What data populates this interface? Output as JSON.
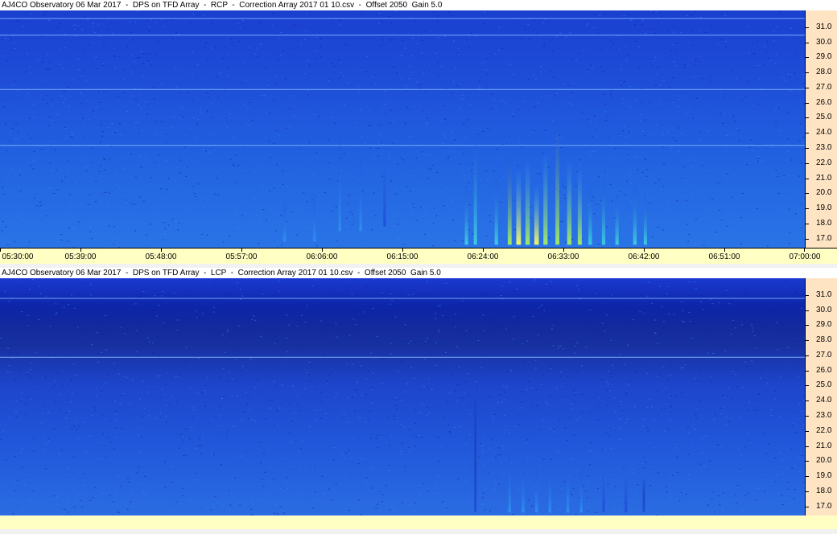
{
  "panels": [
    {
      "title": "AJ4CO Observatory 06 Mar 2017  -  DPS on TFD Array  -  RCP  -  Correction Array 2017 01 10.csv  -  Offset 2050  Gain 5.0"
    },
    {
      "title": "AJ4CO Observatory 06 Mar 2017  -  DPS on TFD Array  -  LCP  -  Correction Array 2017 01 10.csv  -  Offset 2050  Gain 5.0"
    }
  ],
  "chart_data": [
    {
      "type": "heatmap",
      "title": "AJ4CO Observatory 06 Mar 2017  -  DPS on TFD Array  -  RCP  -  Correction Array 2017 01 10.csv  -  Offset 2050  Gain 5.0",
      "polarization": "RCP",
      "x_ticks": [
        "05:30:00",
        "05:39:00",
        "05:48:00",
        "05:57:00",
        "06:06:00",
        "06:15:00",
        "06:24:00",
        "06:33:00",
        "06:42:00",
        "06:51:00",
        "07:00:00"
      ],
      "y_ticks": [
        "31.0",
        "30.0",
        "29.0",
        "28.0",
        "27.0",
        "26.0",
        "25.0",
        "24.0",
        "23.0",
        "22.0",
        "21.0",
        "20.0",
        "19.0",
        "18.0",
        "17.0"
      ],
      "xlim": [
        "05:30:00",
        "07:00:00"
      ],
      "ylim": [
        16.4,
        32.1
      ],
      "colormap": [
        "#0a1a8c",
        "#1e4ed8",
        "#2f8ff0",
        "#40d0e0",
        "#a8f060",
        "#ffff60"
      ],
      "hot_lines_mhz": [
        31.6,
        30.5,
        26.9,
        23.2
      ],
      "bursts": [
        {
          "t": "06:01:50",
          "mhz": [
            16.8,
            19.5
          ],
          "level": 0.45
        },
        {
          "t": "06:05:10",
          "mhz": [
            16.8,
            20.0
          ],
          "level": 0.4
        },
        {
          "t": "06:08:00",
          "mhz": [
            17.5,
            23.8
          ],
          "level": 0.3
        },
        {
          "t": "06:10:20",
          "mhz": [
            17.5,
            22.5
          ],
          "level": 0.3
        },
        {
          "t": "06:13:00",
          "mhz": [
            17.8,
            21.5
          ],
          "level": 0.25
        },
        {
          "t": "06:22:10",
          "mhz": [
            16.6,
            20.5
          ],
          "level": 0.55
        },
        {
          "t": "06:23:10",
          "mhz": [
            16.6,
            24.2
          ],
          "level": 0.5
        },
        {
          "t": "06:25:30",
          "mhz": [
            16.6,
            21.0
          ],
          "level": 0.55
        },
        {
          "t": "06:27:00",
          "mhz": [
            16.6,
            22.5
          ],
          "level": 0.7
        },
        {
          "t": "06:28:00",
          "mhz": [
            16.6,
            21.5
          ],
          "level": 0.95
        },
        {
          "t": "06:29:00",
          "mhz": [
            16.6,
            22.0
          ],
          "level": 0.85
        },
        {
          "t": "06:30:00",
          "mhz": [
            16.6,
            20.5
          ],
          "level": 0.9
        },
        {
          "t": "06:31:00",
          "mhz": [
            16.6,
            22.5
          ],
          "level": 0.8
        },
        {
          "t": "06:32:20",
          "mhz": [
            16.6,
            25.0
          ],
          "level": 0.7
        },
        {
          "t": "06:33:40",
          "mhz": [
            16.6,
            22.0
          ],
          "level": 0.85
        },
        {
          "t": "06:34:50",
          "mhz": [
            16.6,
            21.5
          ],
          "level": 0.75
        },
        {
          "t": "06:36:00",
          "mhz": [
            16.6,
            20.5
          ],
          "level": 0.6
        },
        {
          "t": "06:37:30",
          "mhz": [
            16.6,
            21.0
          ],
          "level": 0.55
        },
        {
          "t": "06:39:00",
          "mhz": [
            16.6,
            20.0
          ],
          "level": 0.55
        },
        {
          "t": "06:41:00",
          "mhz": [
            16.6,
            20.5
          ],
          "level": 0.6
        },
        {
          "t": "06:42:10",
          "mhz": [
            16.6,
            19.8
          ],
          "level": 0.5
        }
      ],
      "legend": "none",
      "grid": false
    },
    {
      "type": "heatmap",
      "title": "AJ4CO Observatory 06 Mar 2017  -  DPS on TFD Array  -  LCP  -  Correction Array 2017 01 10.csv  -  Offset 2050  Gain 5.0",
      "polarization": "LCP",
      "x_ticks": [],
      "y_ticks": [
        "31.0",
        "30.0",
        "29.0",
        "28.0",
        "27.0",
        "26.0",
        "25.0",
        "24.0",
        "23.0",
        "22.0",
        "21.0",
        "20.0",
        "19.0",
        "18.0",
        "17.0"
      ],
      "xlim": [
        "05:30:00",
        "07:00:00"
      ],
      "ylim": [
        16.4,
        32.1
      ],
      "colormap": [
        "#0a1a8c",
        "#1e4ed8",
        "#2f8ff0",
        "#40d0e0",
        "#a8f060",
        "#ffff60"
      ],
      "hot_lines_mhz": [
        30.8,
        26.9
      ],
      "bursts": [
        {
          "t": "06:23:10",
          "mhz": [
            16.6,
            24.0
          ],
          "level": 0.2
        },
        {
          "t": "06:27:00",
          "mhz": [
            16.6,
            20.5
          ],
          "level": 0.35
        },
        {
          "t": "06:28:30",
          "mhz": [
            16.6,
            20.0
          ],
          "level": 0.4
        },
        {
          "t": "06:30:00",
          "mhz": [
            16.6,
            19.5
          ],
          "level": 0.35
        },
        {
          "t": "06:31:30",
          "mhz": [
            16.6,
            20.0
          ],
          "level": 0.35
        },
        {
          "t": "06:33:30",
          "mhz": [
            16.6,
            20.0
          ],
          "level": 0.35
        },
        {
          "t": "06:35:00",
          "mhz": [
            16.6,
            19.5
          ],
          "level": 0.3
        },
        {
          "t": "06:37:30",
          "mhz": [
            16.6,
            19.0
          ],
          "level": 0.25
        },
        {
          "t": "06:40:00",
          "mhz": [
            16.6,
            19.0
          ],
          "level": 0.25
        },
        {
          "t": "06:42:00",
          "mhz": [
            16.6,
            18.8
          ],
          "level": 0.2
        }
      ],
      "legend": "none",
      "grid": false
    }
  ]
}
